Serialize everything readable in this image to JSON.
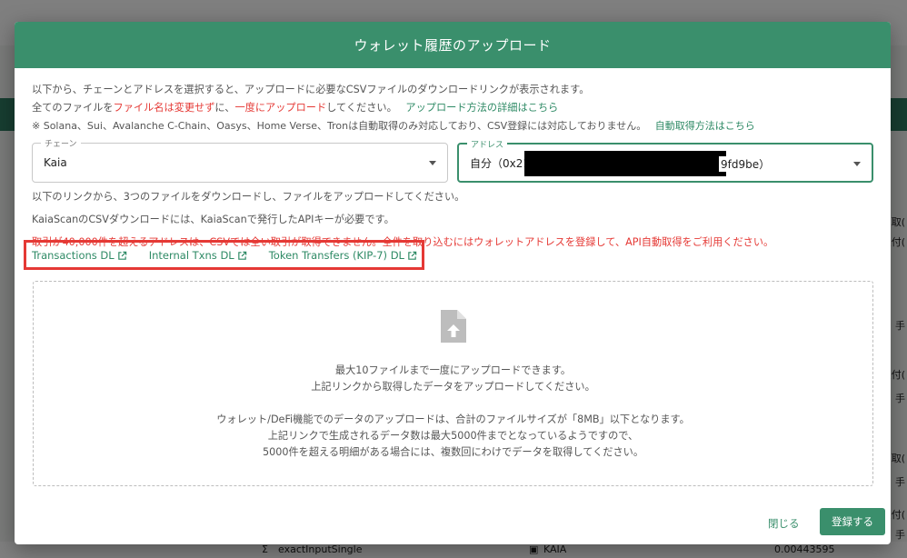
{
  "background": {
    "right_items": [
      "取(",
      "払付(",
      "手",
      "払付(",
      "手",
      "取(",
      "手",
      "払付(",
      "手"
    ],
    "bottom_row": {
      "method": "exactInputSingle",
      "token": "KAIA",
      "amount": "0.00443595"
    }
  },
  "modal": {
    "title": "ウォレット履歴のアップロード",
    "intro_line": "以下から、チェーンとアドレスを選択すると、アップロードに必要なCSVファイルのダウンロードリンクが表示されます。",
    "files_line": {
      "prefix": "全てのファイルを",
      "red1": "ファイル名は変更せず",
      "mid": "に、",
      "red2": "一度にアップロード",
      "suffix": "してください。",
      "link": "アップロード方法の詳細はこちら"
    },
    "note_line": {
      "text": "※ Solana、Sui、Avalanche C-Chain、Oasys、Home Verse、Tronは自動取得のみ対応しており、CSV登録には対応しておりません。",
      "link": "自動取得方法はこちら"
    },
    "chain_field": {
      "label": "チェーン",
      "value": "Kaia"
    },
    "address_field": {
      "label": "アドレス",
      "value_prefix": "自分（0x21",
      "value_suffix": "9fd9be）"
    },
    "instruction_line": "以下のリンクから、3つのファイルをダウンロードし、ファイルをアップロードしてください。",
    "apikey_line": "KaiaScanのCSVダウンロードには、KaiaScanで発行したAPIキーが必要です。",
    "warning_line": "取引が40,000件を超えるアドレスは、CSVでは全い取引が取得できません。全件を取り込むにはウォレットアドレスを登録して、API自動取得をご利用ください。",
    "download_links": [
      "Transactions DL",
      "Internal Txns DL",
      "Token Transfers (KIP-7) DL"
    ],
    "dropzone": {
      "line1": "最大10ファイルまで一度にアップロードできます。",
      "line2": "上記リンクから取得したデータをアップロードしてください。",
      "line3": "ウォレット/DeFi機能でのデータのアップロードは、合計のファイルサイズが「8MB」以下となります。",
      "line4": "上記リンクで生成されるデータ数は最大5000件までとなっているようですので、",
      "line5": "5000件を超える明細がある場合には、複数回にわけでデータを取得してください。"
    },
    "close_label": "閉じる",
    "submit_label": "登録する"
  },
  "colors": {
    "header_green": "#3a8f6c",
    "link_green": "#2e8a65",
    "alert_red": "#e53935"
  }
}
